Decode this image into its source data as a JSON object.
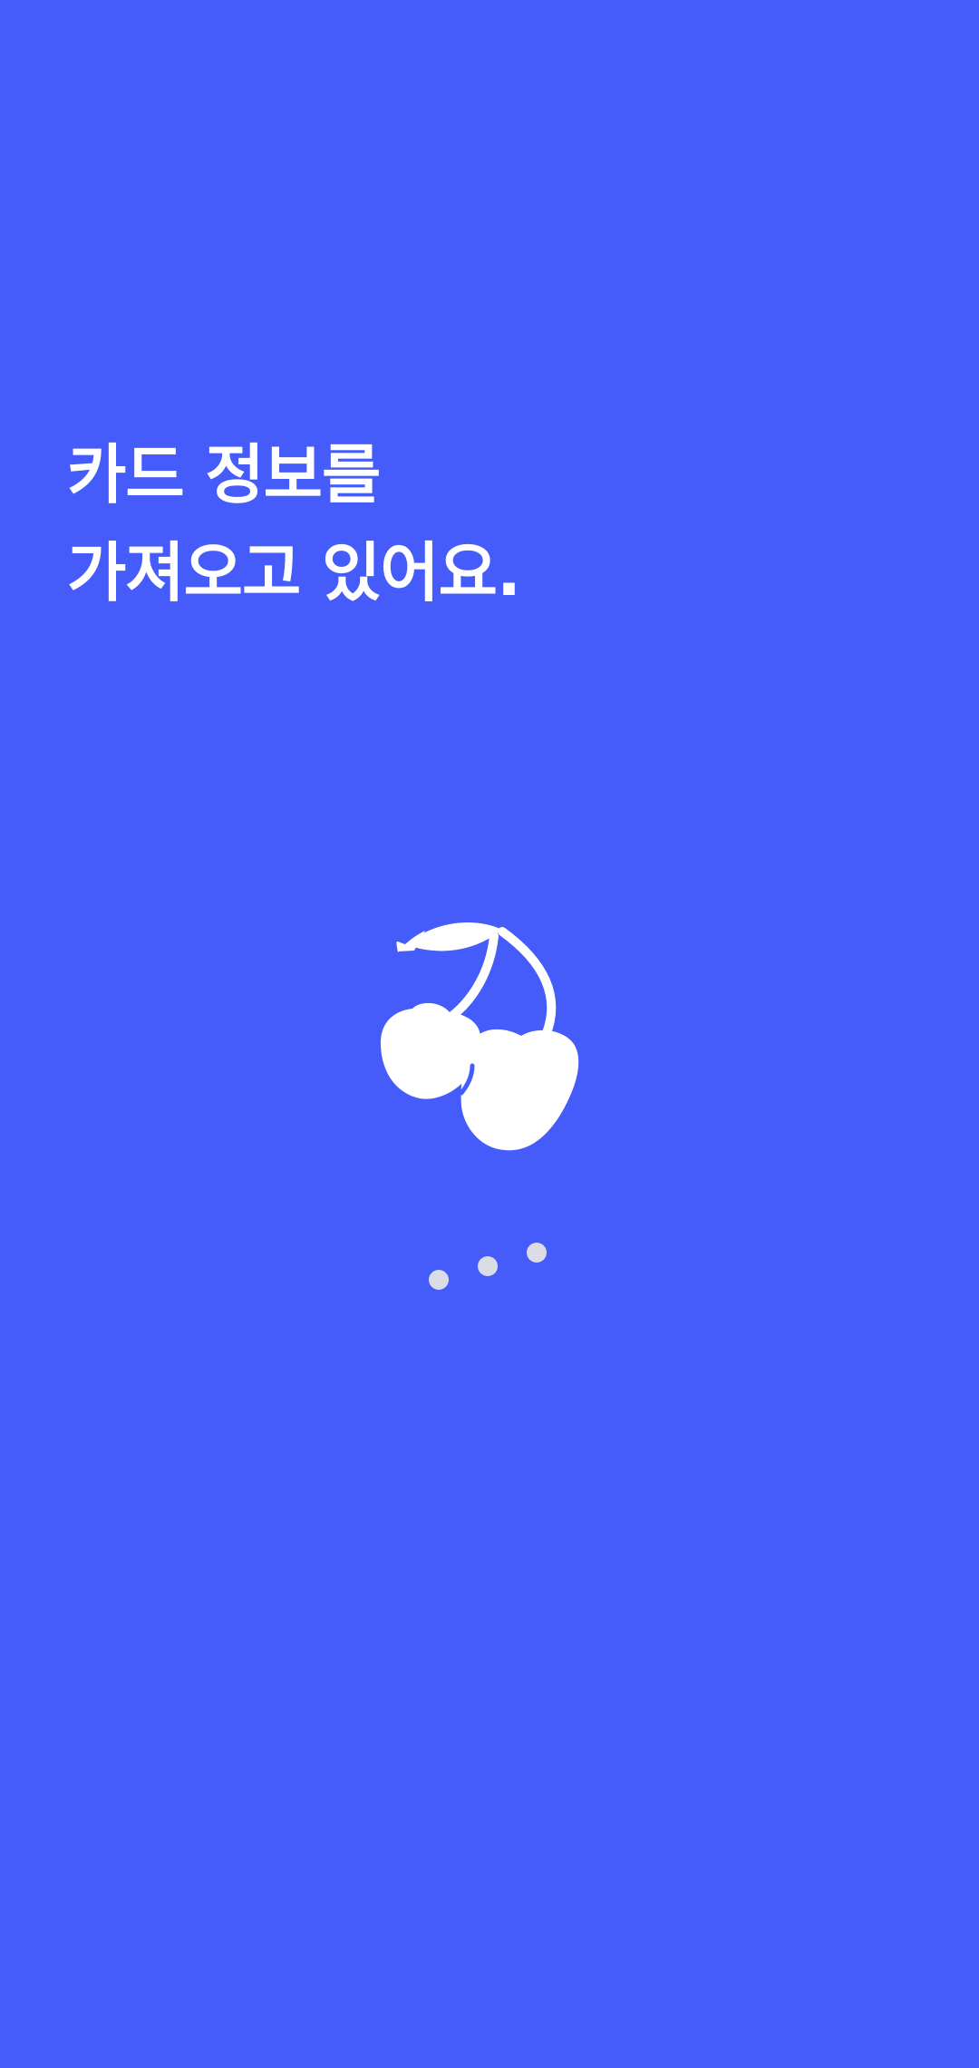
{
  "loading": {
    "line1": "카드 정보를",
    "line2": "가져오고 있어요."
  },
  "icon": "cherry-icon",
  "indicator": {
    "icon": "loading-dots",
    "dot_count": 3
  },
  "colors": {
    "background": "#455CFB",
    "text": "#FFFFFF",
    "dot": "#DADCE6"
  }
}
